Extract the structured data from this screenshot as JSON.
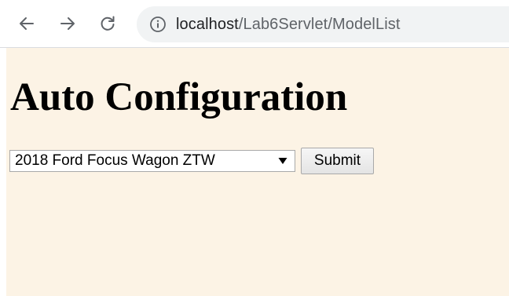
{
  "browser": {
    "back_icon": "arrow-left-icon",
    "forward_icon": "arrow-right-icon",
    "reload_icon": "reload-icon",
    "info_icon": "info-icon",
    "url_host": "localhost",
    "url_path": "/Lab6Servlet/ModelList"
  },
  "page": {
    "title": "Auto Configuration",
    "background_color": "#fcf3e5",
    "model_select": {
      "selected": "2018 Ford Focus Wagon ZTW"
    },
    "submit_label": "Submit"
  }
}
